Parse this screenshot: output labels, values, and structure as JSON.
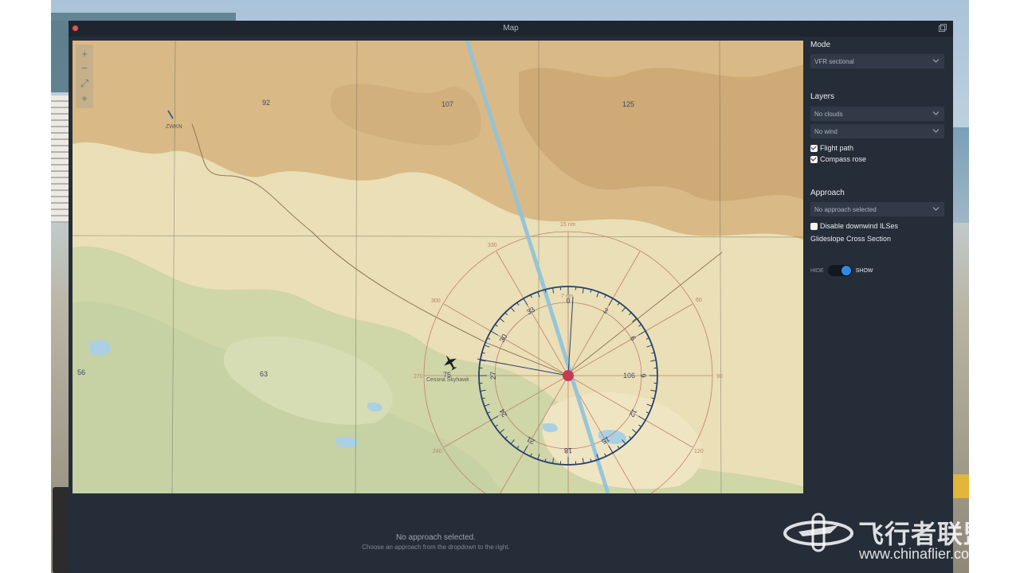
{
  "window": {
    "title": "Map"
  },
  "panel": {
    "mode": {
      "label": "Mode",
      "selected": "VFR sectional"
    },
    "layers": {
      "label": "Layers",
      "clouds": "No clouds",
      "wind": "No wind",
      "flight_path": {
        "label": "Flight path",
        "checked": true
      },
      "compass_rose": {
        "label": "Compass rose",
        "checked": true
      }
    },
    "approach": {
      "label": "Approach",
      "selected": "No approach selected",
      "disable_downwind": {
        "label": "Disable downwind ILSes",
        "checked": false
      },
      "glideslope_label": "Glideslope Cross Section",
      "toggle_off": "HIDE",
      "toggle_on": "SHOW",
      "toggle_state": "SHOW"
    }
  },
  "status": {
    "main": "No approach selected.",
    "sub": "Choose an approach from the dropdown to the right."
  },
  "map": {
    "grid_labels": [
      "92",
      "107",
      "125",
      "56",
      "63",
      "75",
      "106"
    ],
    "waypoint": "ZWKN",
    "aircraft_label": "Cessna Skyhawk",
    "range_outer": "15 nm",
    "range_inner": "7 nm",
    "outer_ring_labels": [
      "330",
      "300",
      "270",
      "240",
      "60",
      "90",
      "120"
    ],
    "compass_labels": [
      "0",
      "3",
      "6",
      "9",
      "12",
      "15",
      "18",
      "21",
      "24",
      "27",
      "30",
      "33"
    ]
  },
  "colors": {
    "window_bg": "#252d38",
    "toggle_accent": "#2f8be8",
    "flight_track": "#8fc3dc",
    "compass_ring": "#26426b",
    "range_rings": "#c0806a"
  },
  "watermark": {
    "text": "飞行者联盟",
    "url": "www.chinaflier.com"
  },
  "icons": [
    "close-icon",
    "popout-icon",
    "zoom-in-icon",
    "zoom-out-icon",
    "fit-icon",
    "center-icon",
    "chevron-down-icon",
    "aircraft-icon"
  ]
}
